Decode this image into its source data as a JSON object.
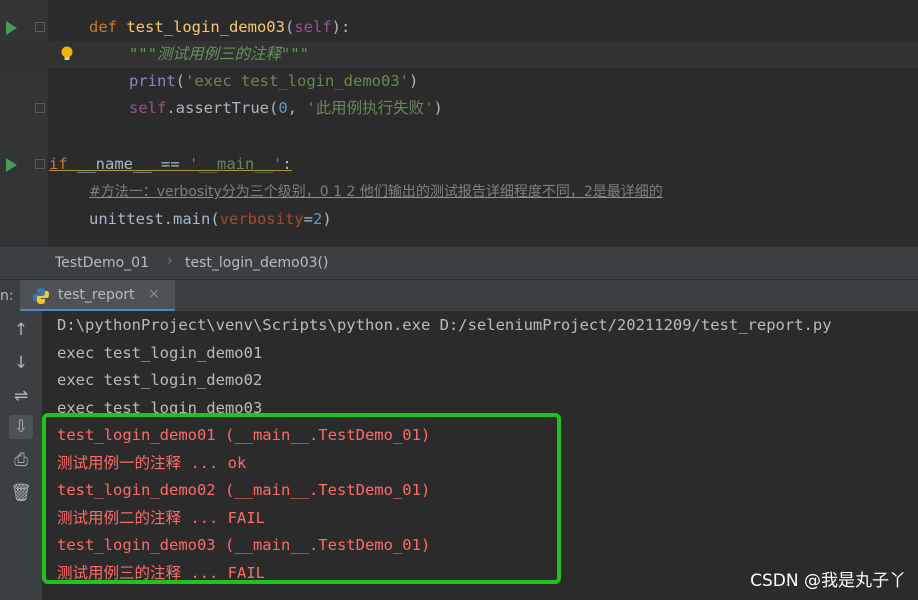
{
  "editor": {
    "lines": {
      "l1": {
        "kw": "def ",
        "fn": "test_login_demo03",
        "p1": "(",
        "self": "self",
        "p2": "):"
      },
      "l2": {
        "doc": "\"\"\"测试用例三的注释\"\"\""
      },
      "l3": {
        "bi": "print",
        "p1": "(",
        "str": "'exec test_login_demo03'",
        "p2": ")"
      },
      "l4": {
        "self": "self",
        "t1": ".assertTrue(",
        "num": "0",
        "t2": ", ",
        "str": "'此用例执行失败'",
        "p2": ")"
      },
      "l6": {
        "kw": "if",
        "t1": " __name__ == ",
        "str": "'__main__'",
        "t2": ":"
      },
      "l7": {
        "cmt": "#方法一：verbosity分为三个级别，0 1 2 他们输出的测试报告详细程度不同，2是最详细的"
      },
      "l8": {
        "t1": "unittest.main(",
        "param": "verbosity",
        "t2": "=",
        "num": "2",
        "t3": ")"
      }
    }
  },
  "breadcrumb": {
    "item1": "TestDemo_01",
    "item2": "test_login_demo03()",
    "sep": "›"
  },
  "run_panel": {
    "prefix": "n:",
    "tab_label": "test_report",
    "close": "×"
  },
  "toolbar": {
    "up": "↑",
    "down": "↓",
    "wrap": "⇌",
    "scroll": "⇩",
    "print": "⎙",
    "trash": "🗑"
  },
  "console": {
    "lines": [
      "D:\\pythonProject\\venv\\Scripts\\python.exe D:/seleniumProject/20211209/test_report.py",
      "exec test_login_demo01",
      "exec test_login_demo02",
      "exec test_login_demo03",
      "test_login_demo01 (__main__.TestDemo_01)",
      "测试用例一的注释 ... ok",
      "test_login_demo02 (__main__.TestDemo_01)",
      "测试用例二的注释 ... FAIL",
      "test_login_demo03 (__main__.TestDemo_01)",
      "测试用例三的注释 ... FAIL"
    ]
  },
  "watermark": "CSDN @我是丸子丫",
  "colors": {
    "highlight": "#1ec41e",
    "error_text": "#ff6b68",
    "run_icon": "#499c54",
    "tab_underline": "#4a88c7"
  }
}
